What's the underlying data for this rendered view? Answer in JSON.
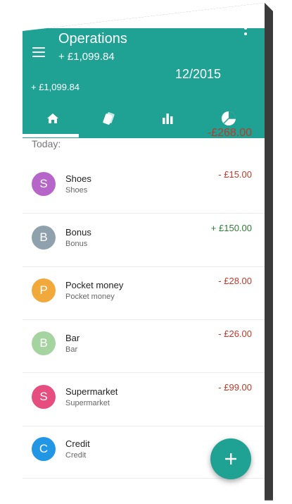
{
  "header": {
    "title": "Operations",
    "subtitle_balance": "+ £1,099.84",
    "balance": "+ £1,099.84",
    "period": "12/2015"
  },
  "tabs": [
    {
      "icon": "home-icon",
      "active": true
    },
    {
      "icon": "cards-icon",
      "active": false
    },
    {
      "icon": "bar-chart-icon",
      "active": false
    },
    {
      "icon": "pie-chart-icon",
      "active": false
    }
  ],
  "section": {
    "label": "Today:",
    "total": "-£268.00"
  },
  "operations": [
    {
      "letter": "S",
      "title": "Shoes",
      "subtitle": "Shoes",
      "amount": "- £15.00",
      "sign": "neg",
      "color": "#b666c9"
    },
    {
      "letter": "B",
      "title": "Bonus",
      "subtitle": "Bonus",
      "amount": "+ £150.00",
      "sign": "pos",
      "color": "#8fa1ad"
    },
    {
      "letter": "P",
      "title": "Pocket money",
      "subtitle": "Pocket money",
      "amount": "- £28.00",
      "sign": "neg",
      "color": "#f2a93b"
    },
    {
      "letter": "B",
      "title": "Bar",
      "subtitle": "Bar",
      "amount": "- £26.00",
      "sign": "neg",
      "color": "#a6d4a0"
    },
    {
      "letter": "S",
      "title": "Supermarket",
      "subtitle": "Supermarket",
      "amount": "- £99.00",
      "sign": "neg",
      "color": "#e54e7e"
    },
    {
      "letter": "C",
      "title": "Credit",
      "subtitle": "Credit",
      "amount": "",
      "sign": "neg",
      "color": "#2196e5"
    }
  ],
  "colors": {
    "accent": "#1fa293",
    "negative": "#c0392b",
    "positive": "#2e7d32"
  },
  "fab": {
    "icon": "plus-icon"
  }
}
